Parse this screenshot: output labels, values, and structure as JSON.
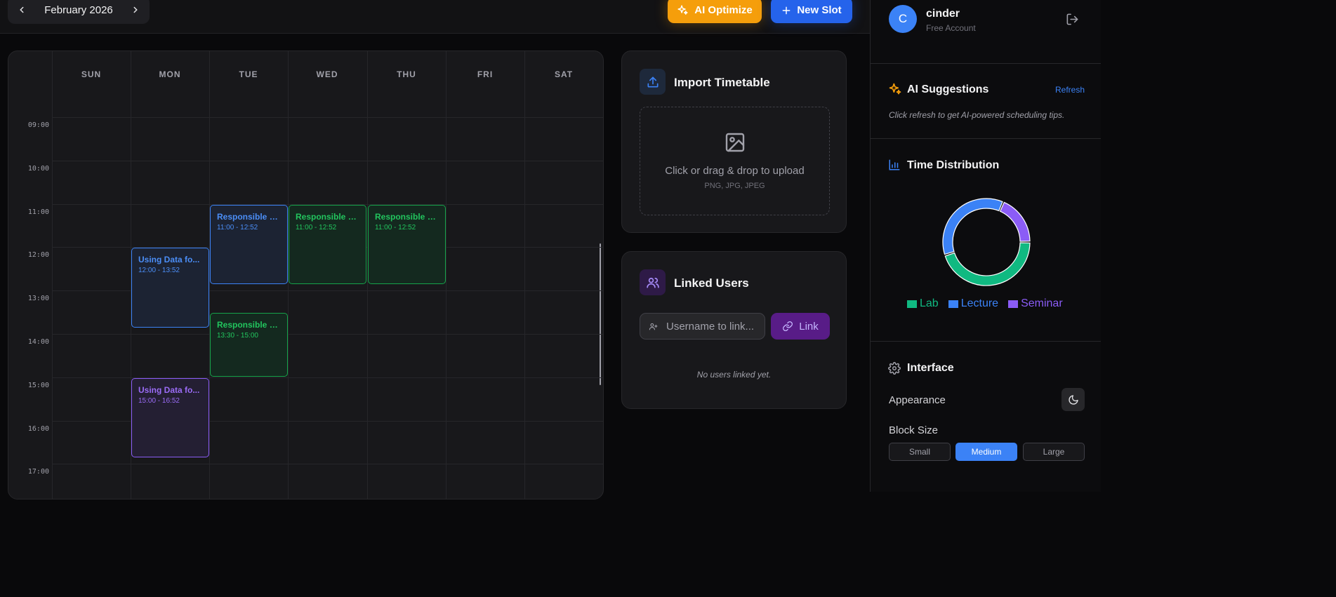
{
  "header": {
    "month": "February 2026",
    "ai_button": "AI Optimize",
    "new_button": "New Slot"
  },
  "calendar": {
    "days": [
      "SUN",
      "MON",
      "TUE",
      "WED",
      "THU",
      "FRI",
      "SAT"
    ],
    "hours": [
      "09:00",
      "10:00",
      "11:00",
      "12:00",
      "13:00",
      "14:00",
      "15:00",
      "16:00",
      "17:00"
    ],
    "events": [
      {
        "title": "Responsible D...",
        "time": "11:00 - 12:52",
        "day": 2,
        "start": 11.0,
        "end": 12.87,
        "type": "Lecture"
      },
      {
        "title": "Responsible D...",
        "time": "11:00 - 12:52",
        "day": 3,
        "start": 11.0,
        "end": 12.87,
        "type": "Lab"
      },
      {
        "title": "Responsible D...",
        "time": "11:00 - 12:52",
        "day": 4,
        "start": 11.0,
        "end": 12.87,
        "type": "Lab"
      },
      {
        "title": "Using Data fo...",
        "time": "12:00 - 13:52",
        "day": 1,
        "start": 12.0,
        "end": 13.87,
        "type": "Lecture"
      },
      {
        "title": "Responsible D...",
        "time": "13:30 - 15:00",
        "day": 2,
        "start": 13.5,
        "end": 15.0,
        "type": "Lab"
      },
      {
        "title": "Using Data fo...",
        "time": "15:00 - 16:52",
        "day": 1,
        "start": 15.0,
        "end": 16.87,
        "type": "Seminar"
      }
    ]
  },
  "import_card": {
    "title": "Import Timetable",
    "upload_text": "Click or drag & drop to upload",
    "formats": "PNG, JPG, JPEG"
  },
  "linked_card": {
    "title": "Linked Users",
    "placeholder": "Username to link...",
    "link_button": "Link",
    "empty_text": "No users linked yet."
  },
  "sidebar": {
    "avatar_letter": "C",
    "user_name": "cinder",
    "plan": "Free Account",
    "ai_title": "AI Suggestions",
    "refresh": "Refresh",
    "ai_tip": "Click refresh to get AI-powered scheduling tips.",
    "dist_title": "Time Distribution",
    "interface_title": "Interface",
    "appearance_label": "Appearance",
    "block_size_label": "Block Size",
    "sizes": [
      "Small",
      "Medium",
      "Large"
    ],
    "active_size": 1
  },
  "chart_data": {
    "type": "pie",
    "categories": [
      "Lab",
      "Lecture",
      "Seminar"
    ],
    "values": [
      4.6,
      3.7,
      1.9
    ],
    "colors": [
      "#10b981",
      "#3b82f6",
      "#8b5cf6"
    ],
    "legend": "bottom"
  },
  "colors": {
    "Lab": "#10b981",
    "Lecture": "#3b82f6",
    "Seminar": "#8b5cf6",
    "accent": "#3b82f6",
    "ai": "#f59e0b"
  }
}
